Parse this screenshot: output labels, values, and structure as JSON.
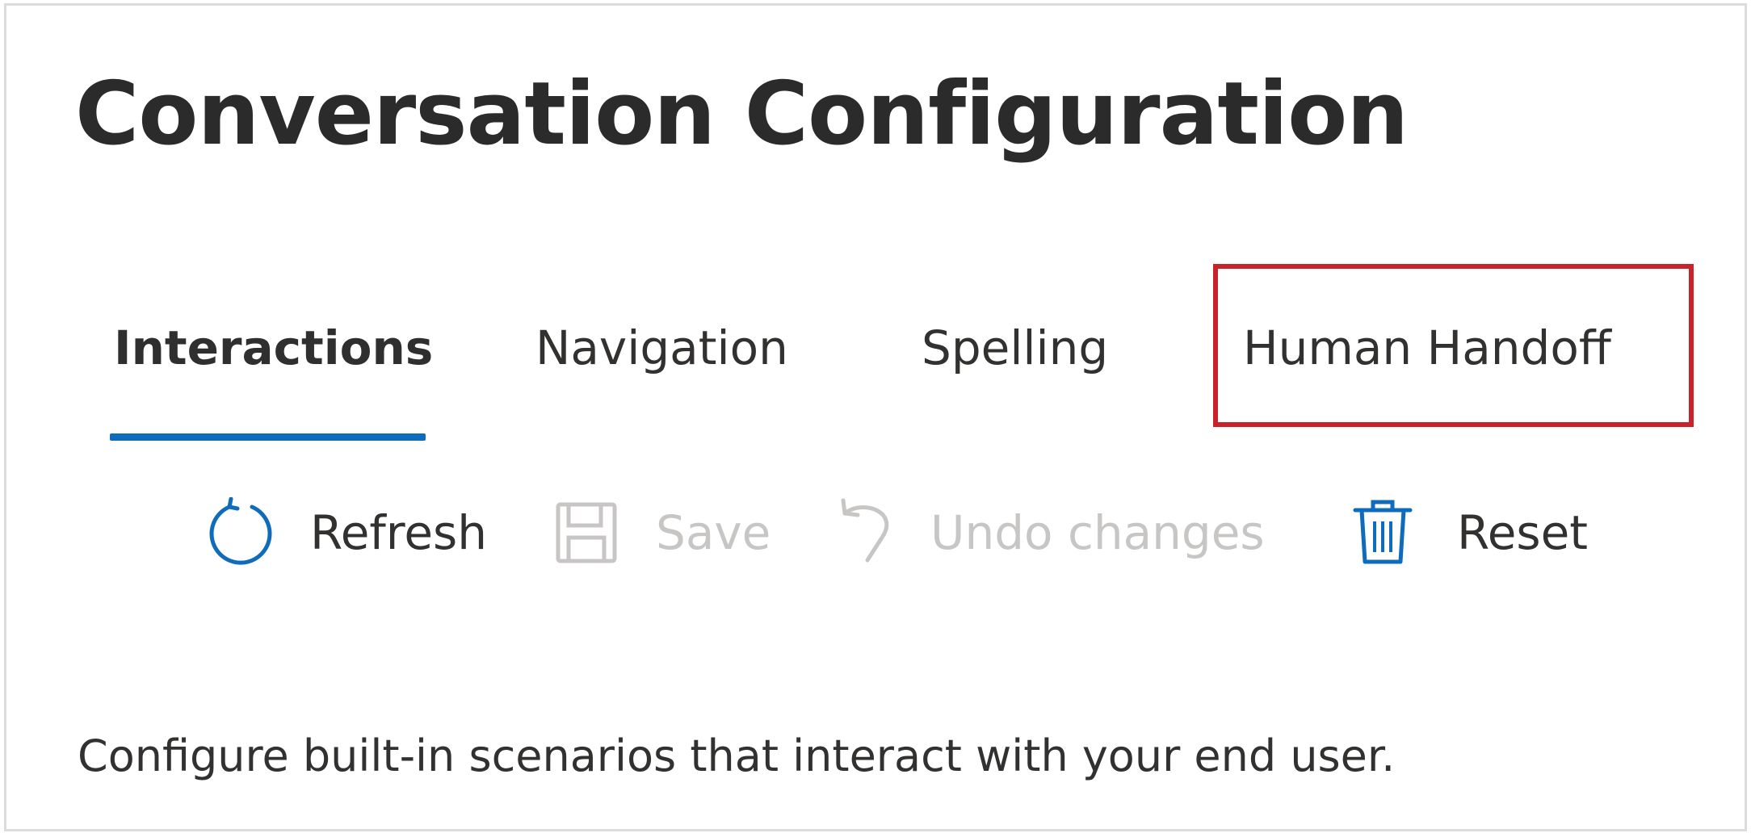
{
  "page": {
    "title": "Conversation Configuration",
    "description": "Configure built-in scenarios that interact with your end user."
  },
  "tabs": [
    {
      "label": "Interactions",
      "selected": true
    },
    {
      "label": "Navigation",
      "selected": false
    },
    {
      "label": "Spelling",
      "selected": false
    },
    {
      "label": "Human Handoff",
      "selected": false,
      "highlighted": true
    }
  ],
  "toolbar": {
    "refresh": {
      "label": "Refresh",
      "icon": "refresh-icon",
      "enabled": true
    },
    "save": {
      "label": "Save",
      "icon": "save-icon",
      "enabled": false
    },
    "undo": {
      "label": "Undo changes",
      "icon": "undo-icon",
      "enabled": false
    },
    "reset": {
      "label": "Reset",
      "icon": "trash-icon",
      "enabled": true
    }
  },
  "colors": {
    "accent": "#0f6cbd",
    "highlight": "#c8232b",
    "text": "#323130",
    "disabled": "#c8c6c4"
  }
}
